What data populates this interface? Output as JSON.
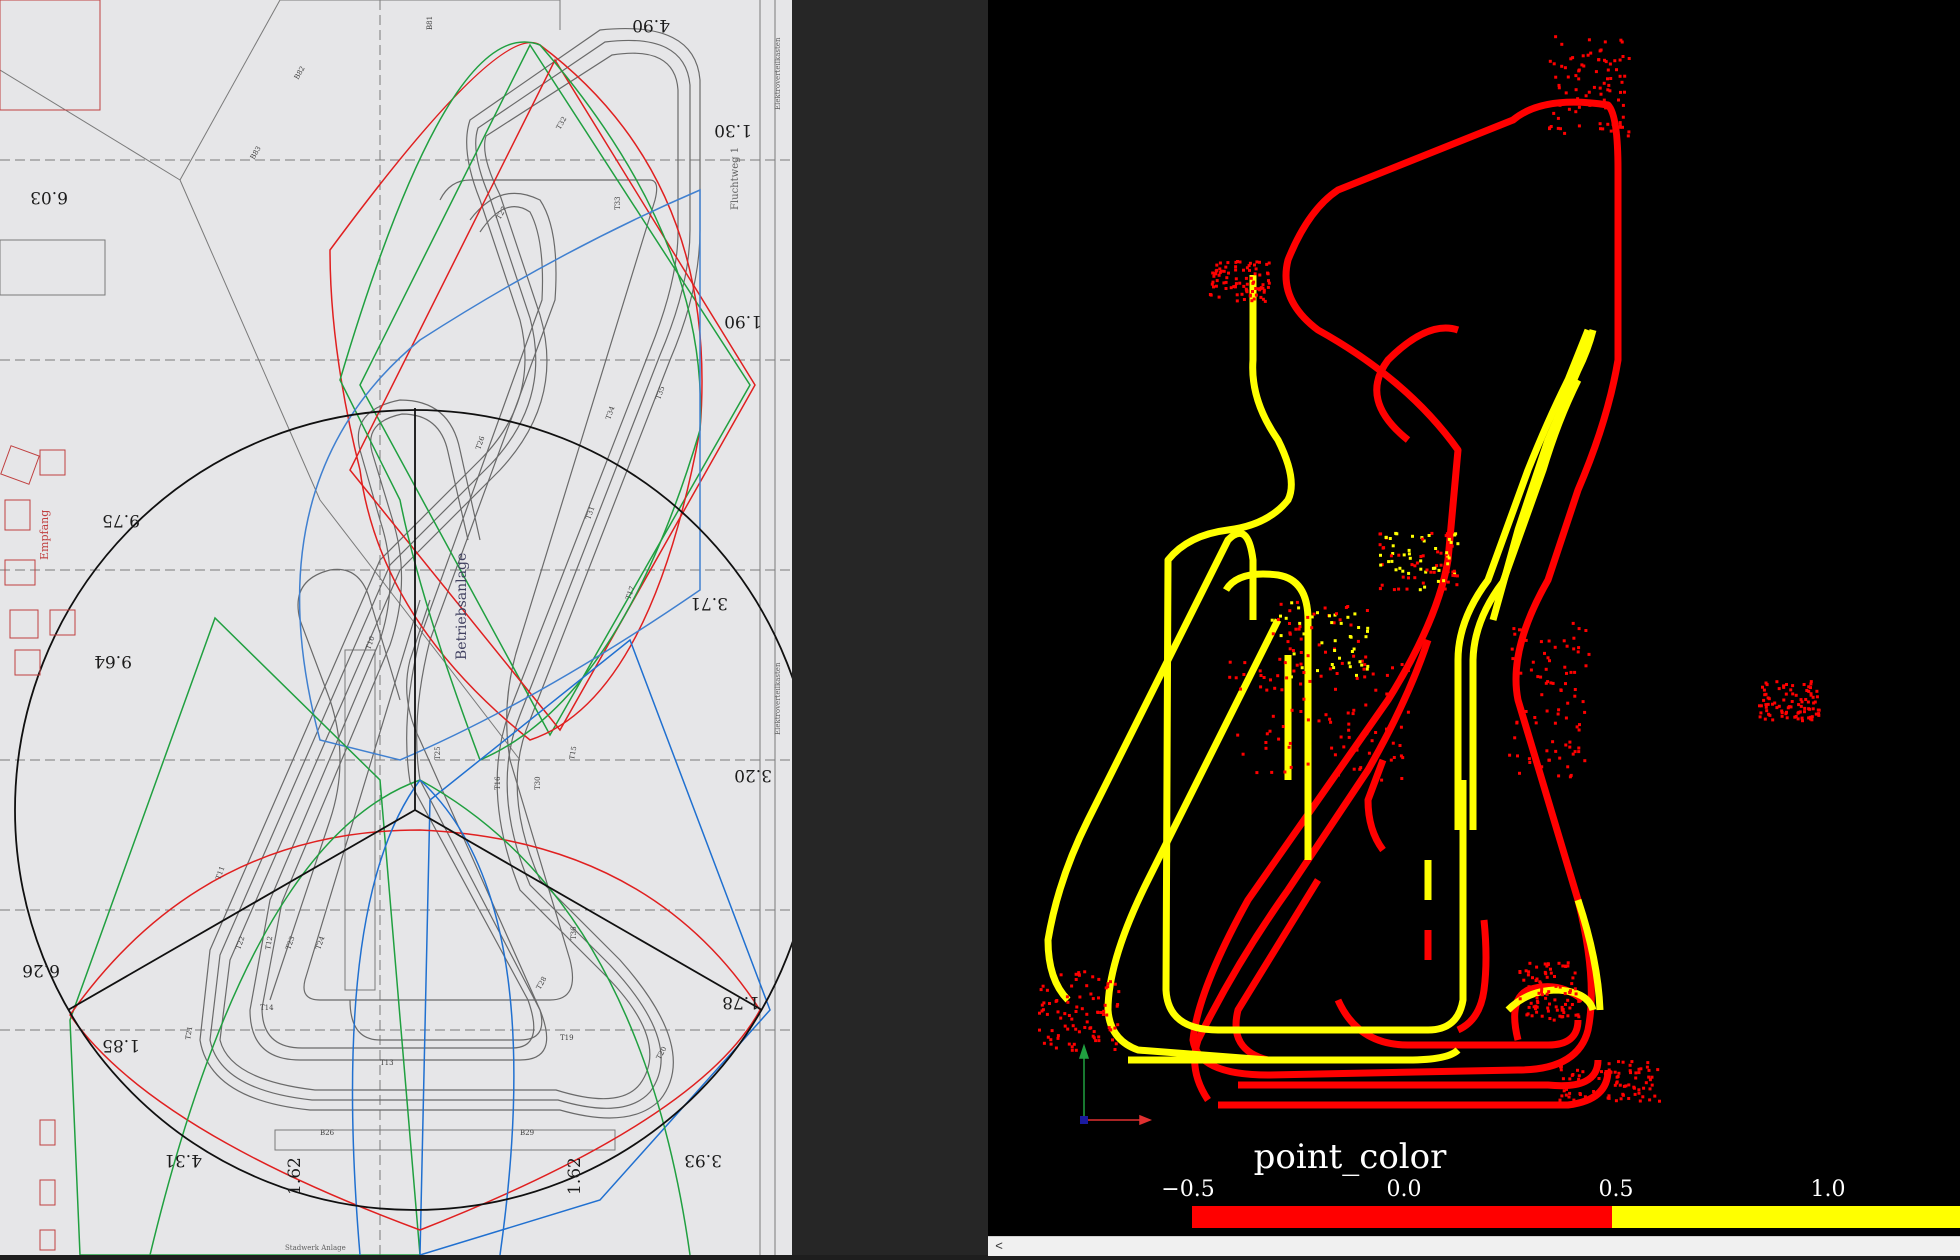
{
  "floorplan": {
    "dimensions": [
      "4.90",
      "1.30",
      "6.03",
      "1.90",
      "9.75",
      "3.71",
      "9.64",
      "3.20",
      "6.26",
      "1.78",
      "1.85",
      "4.31",
      "1.62",
      "1.62",
      "3.93"
    ],
    "labels": {
      "betriebsanlage": "Betriebsanlage",
      "empfang": "Empfang",
      "fluchtweg": "Fluchtweg 1",
      "elektro1": "Elektroverteilkasten",
      "elektro2": "Elektroverteilkasten",
      "stadwerk": "Stadwerk Anlage"
    },
    "track_ids": [
      "B81",
      "B82",
      "B83",
      "T32",
      "T31",
      "T33",
      "T30",
      "T13",
      "T34",
      "T35",
      "T36",
      "T15",
      "T14",
      "T12",
      "T11",
      "T10",
      "T17",
      "T16",
      "T19",
      "T20",
      "T21",
      "T22",
      "T23",
      "T24",
      "T25",
      "T26",
      "T27",
      "T28",
      "B26",
      "B29"
    ]
  },
  "viewer": {
    "colorbar": {
      "title": "point_color",
      "ticks": [
        "−0.5",
        "0.0",
        "0.5",
        "1.0"
      ],
      "low_color": "#ff0000",
      "high_color": "#ffff00"
    },
    "axes_colors": {
      "x": "#e03030",
      "y": "#20a040",
      "z": "#1a1aa0"
    },
    "point_colors": [
      "#ff0000",
      "#ffff00"
    ]
  },
  "scrollbar": {
    "left_arrow": "<"
  }
}
